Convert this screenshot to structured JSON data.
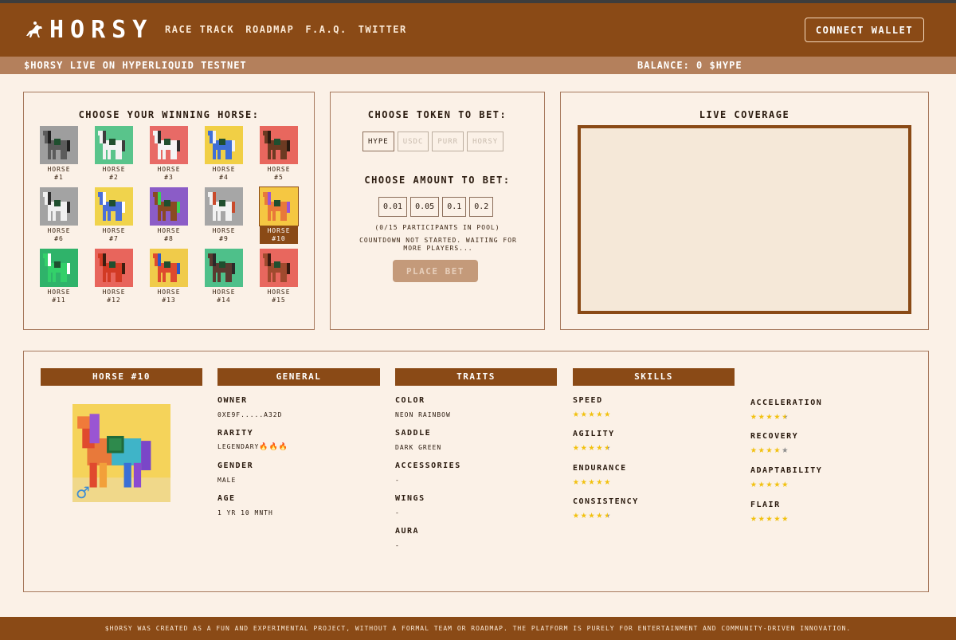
{
  "header": {
    "logo_text": "HORSY",
    "nav": [
      "RACE TRACK",
      "ROADMAP",
      "F.A.Q.",
      "TWITTER"
    ],
    "connect_label": "CONNECT WALLET"
  },
  "subbar": {
    "left": "$HORSY LIVE ON HYPERLIQUID TESTNET",
    "right": "BALANCE: 0 $HYPE"
  },
  "choose_horse": {
    "title": "CHOOSE YOUR WINNING HORSE:",
    "selected_index": 9,
    "horses": [
      {
        "label": "HORSE",
        "num": "#1",
        "bg": "#9e9e9e",
        "body": "#5b5b5b",
        "mane": "#1f1f1f"
      },
      {
        "label": "HORSE",
        "num": "#2",
        "bg": "#59c48b",
        "body": "#f2f2f2",
        "mane": "#3d3d3d"
      },
      {
        "label": "HORSE",
        "num": "#3",
        "bg": "#e86a66",
        "body": "#f4f4f4",
        "mane": "#2b2b2b"
      },
      {
        "label": "HORSE",
        "num": "#4",
        "bg": "#f1cf45",
        "body": "#3f6fd6",
        "mane": "#f2f2f2"
      },
      {
        "label": "HORSE",
        "num": "#5",
        "bg": "#e8675e",
        "body": "#6c3a22",
        "mane": "#2b1a10"
      },
      {
        "label": "HORSE",
        "num": "#6",
        "bg": "#a3a3a3",
        "body": "#f0f0f0",
        "mane": "#2d2d2d"
      },
      {
        "label": "HORSE",
        "num": "#7",
        "bg": "#f0d34c",
        "body": "#4a6fd8",
        "mane": "#ffffff"
      },
      {
        "label": "HORSE",
        "num": "#8",
        "bg": "#8b5cc7",
        "body": "#8a4a22",
        "mane": "#3bd157"
      },
      {
        "label": "HORSE",
        "num": "#9",
        "bg": "#a6a6a6",
        "body": "#f1f1f1",
        "mane": "#c94a2b"
      },
      {
        "label": "HORSE",
        "num": "#10",
        "bg": "#f5c742",
        "body": "#e8793a",
        "mane": "#9a55d3"
      },
      {
        "label": "HORSE",
        "num": "#11",
        "bg": "#2fb36a",
        "body": "#33d06a",
        "mane": "#ffffff"
      },
      {
        "label": "HORSE",
        "num": "#12",
        "bg": "#e8655c",
        "body": "#d23a24",
        "mane": "#3b1e10"
      },
      {
        "label": "HORSE",
        "num": "#13",
        "bg": "#f0cb4a",
        "body": "#de4a2e",
        "mane": "#2b5ac7"
      },
      {
        "label": "HORSE",
        "num": "#14",
        "bg": "#4ec08a",
        "body": "#5a3a30",
        "mane": "#2a2a2a"
      },
      {
        "label": "HORSE",
        "num": "#15",
        "bg": "#e8675e",
        "body": "#a04a2e",
        "mane": "#3a1a10"
      }
    ]
  },
  "bet": {
    "token_title": "CHOOSE TOKEN TO BET:",
    "tokens": [
      "HYPE",
      "USDC",
      "PURR",
      "HORSY"
    ],
    "amount_title": "CHOOSE AMOUNT TO BET:",
    "amounts": [
      "0.01",
      "0.05",
      "0.1",
      "0.2"
    ],
    "participants": "(0/15 PARTICIPANTS IN POOL)",
    "countdown": "COUNTDOWN NOT STARTED. WAITING FOR MORE PLAYERS...",
    "place_label": "PLACE BET"
  },
  "coverage": {
    "title": "LIVE COVERAGE"
  },
  "details": {
    "horse_title": "HORSE #10",
    "gender_icon": "male-symbol-icon",
    "general": {
      "title": "GENERAL",
      "owner_label": "OWNER",
      "owner": "0XE9F.....A32D",
      "rarity_label": "RARITY",
      "rarity": "LEGENDARY",
      "gender_label": "GENDER",
      "gender": "MALE",
      "age_label": "AGE",
      "age": "1 YR 10 MNTH"
    },
    "traits": {
      "title": "TRAITS",
      "color_label": "COLOR",
      "color": "NEON RAINBOW",
      "saddle_label": "SADDLE",
      "saddle": "DARK GREEN",
      "accessories_label": "ACCESSORIES",
      "accessories": "-",
      "wings_label": "WINGS",
      "wings": "-",
      "aura_label": "AURA",
      "aura": "-"
    },
    "skills": {
      "title": "SKILLS",
      "list": [
        {
          "name": "SPEED",
          "rating": 5
        },
        {
          "name": "AGILITY",
          "rating": 4.5
        },
        {
          "name": "ENDURANCE",
          "rating": 5
        },
        {
          "name": "CONSISTENCY",
          "rating": 4.5
        },
        {
          "name": "ACCELERATION",
          "rating": 4.5
        },
        {
          "name": "RECOVERY",
          "rating": 4
        },
        {
          "name": "ADAPTABILITY",
          "rating": 5
        },
        {
          "name": "FLAIR",
          "rating": 5
        }
      ]
    }
  },
  "footer": "$HORSY WAS CREATED AS A FUN AND EXPERIMENTAL PROJECT, WITHOUT A FORMAL TEAM OR ROADMAP. THE PLATFORM IS PURELY FOR ENTERTAINMENT AND COMMUNITY-DRIVEN INNOVATION.",
  "colors": {
    "brand": "#8a4a16",
    "accent": "#b4805c",
    "background": "#fbf1e7",
    "star": "#f2c10f"
  }
}
